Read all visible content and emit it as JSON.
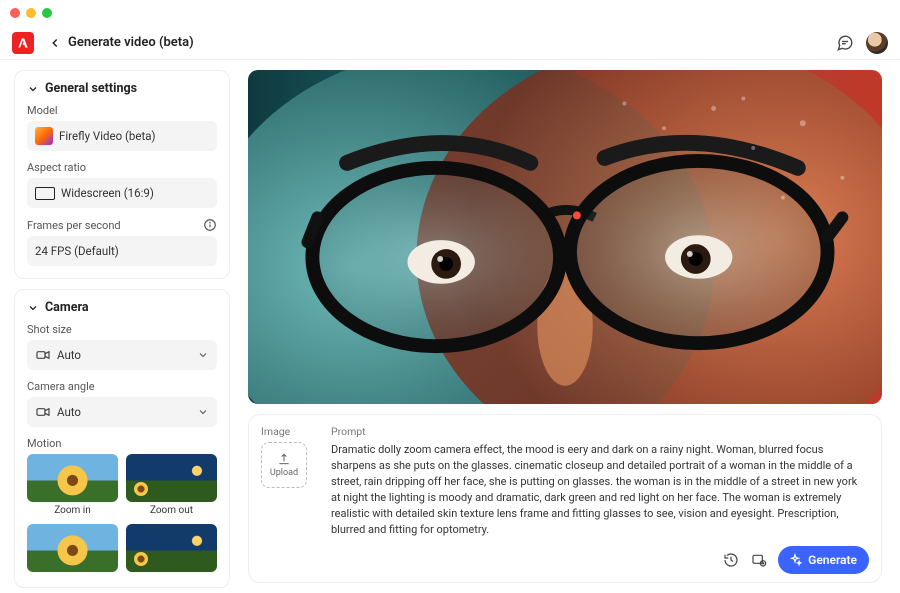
{
  "header": {
    "title": "Generate video (beta)"
  },
  "sidebar": {
    "general": {
      "heading": "General settings",
      "model_label": "Model",
      "model_value": "Firefly Video (beta)",
      "aspect_label": "Aspect ratio",
      "aspect_value": "Widescreen (16:9)",
      "fps_label": "Frames per second",
      "fps_value": "24 FPS (Default)"
    },
    "camera": {
      "heading": "Camera",
      "shot_label": "Shot size",
      "shot_value": "Auto",
      "angle_label": "Camera angle",
      "angle_value": "Auto",
      "motion_label": "Motion",
      "motion_items": [
        {
          "caption": "Zoom in"
        },
        {
          "caption": "Zoom out"
        },
        {
          "caption": ""
        },
        {
          "caption": ""
        }
      ]
    }
  },
  "prompt": {
    "image_label": "Image",
    "upload_label": "Upload",
    "prompt_label": "Prompt",
    "text": "Dramatic dolly zoom camera effect, the mood is eery and dark on a rainy night. Woman, blurred focus sharpens as she puts on the glasses. cinematic closeup and detailed portrait of a woman in the middle of a street, rain dripping off her face, she is putting on glasses. the woman is in the middle of a street in new york at night the lighting is moody and dramatic, dark green and red light on her face. The woman is extremely realistic with detailed skin texture lens frame and fitting glasses to see, vision and eyesight. Prescription, blurred and fitting for optometry.",
    "generate_label": "Generate"
  }
}
